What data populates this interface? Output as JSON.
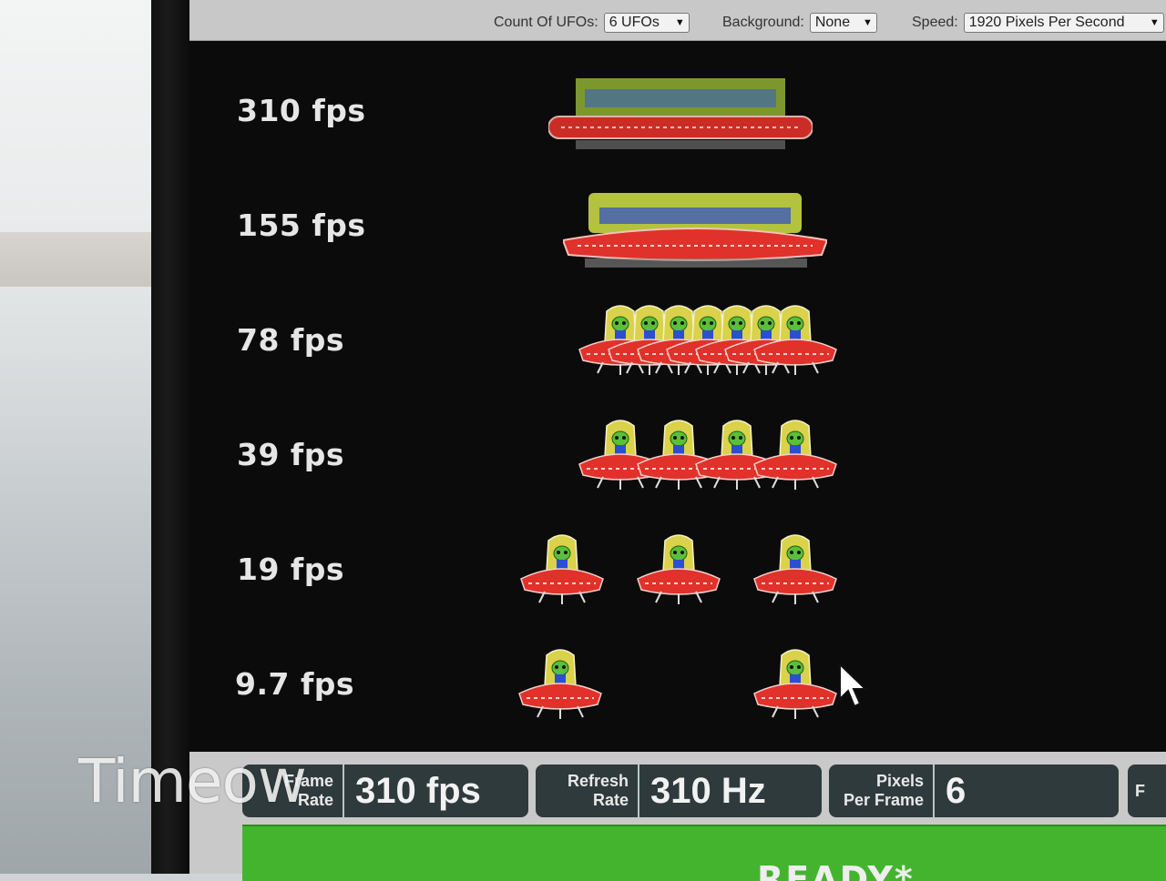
{
  "controls": {
    "count_label": "Count Of UFOs:",
    "count_value": "6 UFOs",
    "background_label": "Background:",
    "background_value": "None",
    "speed_label": "Speed:",
    "speed_value": "1920 Pixels Per Second"
  },
  "rows": [
    {
      "label": "310 fps"
    },
    {
      "label": "155 fps"
    },
    {
      "label": "78 fps"
    },
    {
      "label": "39 fps"
    },
    {
      "label": "19 fps"
    },
    {
      "label": "9.7 fps"
    }
  ],
  "stats": {
    "frame_rate_key_1": "Frame",
    "frame_rate_key_2": "Rate",
    "frame_rate_value": "310 fps",
    "refresh_rate_key_1": "Refresh",
    "refresh_rate_key_2": "Rate",
    "refresh_rate_value": "310 Hz",
    "ppf_key_1": "Pixels",
    "ppf_key_2": "Per Frame",
    "ppf_value": "6",
    "partial_key": "F"
  },
  "status": {
    "ready_text": "READY*"
  },
  "watermark": "Timeow",
  "colors": {
    "ufo_saucer": "#e0312a",
    "ufo_dome": "#d9d24a",
    "alien": "#5bbf3a",
    "alien_body": "#2a4fd0",
    "ready_bar": "#44b42f",
    "stat_box": "#2f3a3c"
  }
}
